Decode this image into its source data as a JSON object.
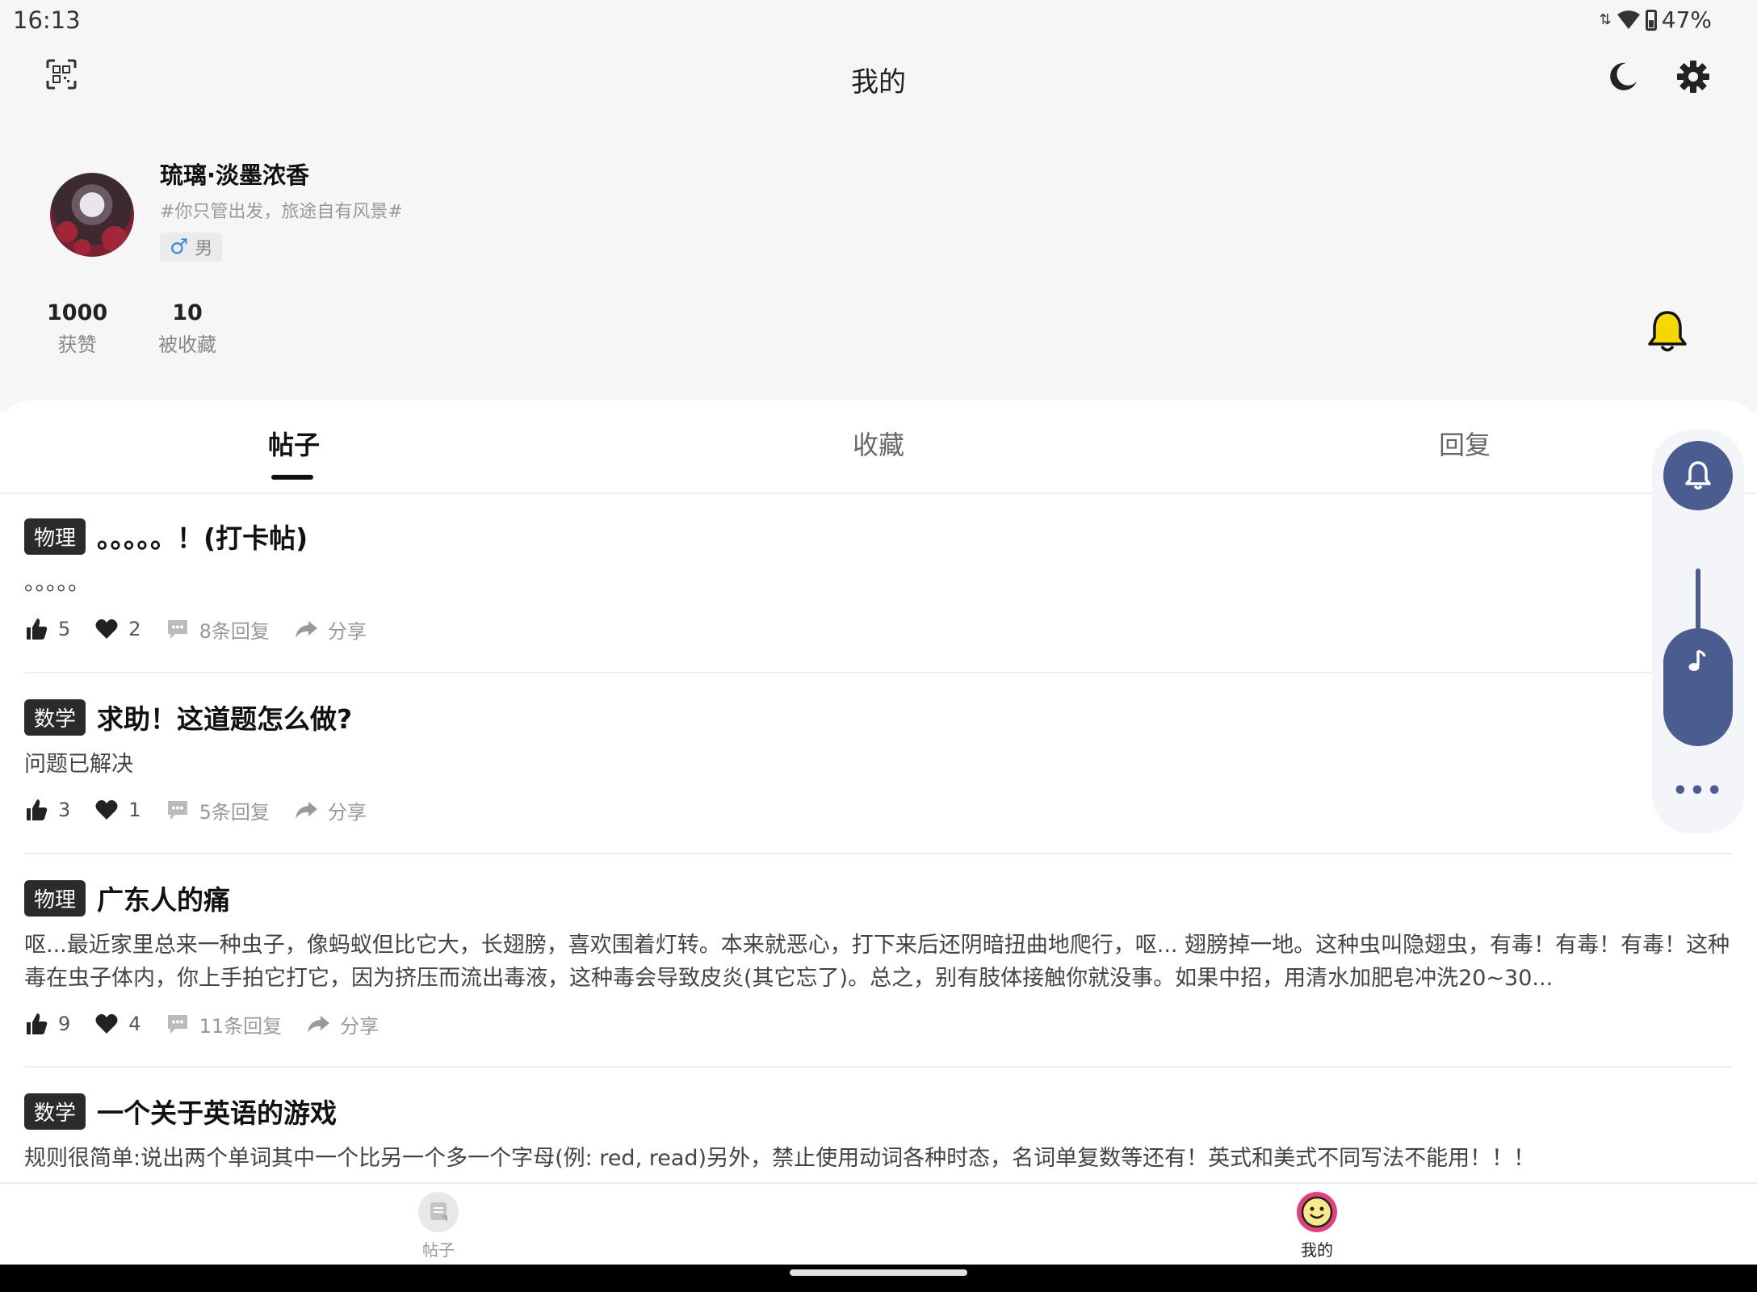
{
  "status_bar": {
    "time": "16:13",
    "battery": "47%"
  },
  "app_bar": {
    "title": "我的"
  },
  "profile": {
    "username": "琉璃·淡墨浓香",
    "signature": "#你只管出发，旅途自有风景#",
    "gender_symbol": "♂",
    "gender": "男",
    "stats": [
      {
        "value": "1000",
        "label": "获赞"
      },
      {
        "value": "10",
        "label": "被收藏"
      }
    ]
  },
  "tabs": [
    {
      "label": "帖子",
      "active": true
    },
    {
      "label": "收藏",
      "active": false
    },
    {
      "label": "回复",
      "active": false
    }
  ],
  "posts": [
    {
      "tag": "物理",
      "title": "。。。。。！(打卡帖)",
      "body": "。。。。。",
      "likes": "5",
      "favorites": "2",
      "replies": "8条回复",
      "share": "分享"
    },
    {
      "tag": "数学",
      "title": "求助！这道题怎么做?",
      "body": "问题已解决",
      "likes": "3",
      "favorites": "1",
      "replies": "5条回复",
      "share": "分享"
    },
    {
      "tag": "物理",
      "title": "广东人的痛",
      "body": "呕...最近家里总来一种虫子，像蚂蚁但比它大，长翅膀，喜欢围着灯转。本来就恶心，打下来后还阴暗扭曲地爬行，呕... 翅膀掉一地。这种虫叫隐翅虫，有毒！有毒！有毒！这种毒在虫子体内，你上手拍它打它，因为挤压而流出毒液，这种毒会导致皮炎(其它忘了)。总之，别有肢体接触你就没事。如果中招，用清水加肥皂冲洗20~30...",
      "likes": "9",
      "favorites": "4",
      "replies": "11条回复",
      "share": "分享"
    },
    {
      "tag": "数学",
      "title": "一个关于英语的游戏",
      "body": "规则很简单:说出两个单词其中一个比另一个多一个字母(例: red, read)另外，禁止使用动词各种时态，名词单复数等还有！英式和美式不同写法不能用！！！"
    }
  ],
  "floating_panel": {
    "more": "•••"
  },
  "bottom_nav": [
    {
      "label": "帖子",
      "active": false
    },
    {
      "label": "我的",
      "active": true
    }
  ],
  "colors": {
    "accent": "#4b5c91",
    "bell": "#f5d800",
    "mine_icon": "#e0417a",
    "male": "#3a8ad8"
  },
  "icons": {
    "top_left": "qr-scan-icon",
    "top_right": [
      "moon-icon",
      "gear-icon"
    ],
    "profile_right": "bell-icon",
    "actions": [
      "thumbs-up-icon",
      "heart-icon",
      "comment-icon",
      "share-icon"
    ],
    "floating": [
      "bell-icon",
      "music-note-icon",
      "more-icon"
    ]
  }
}
